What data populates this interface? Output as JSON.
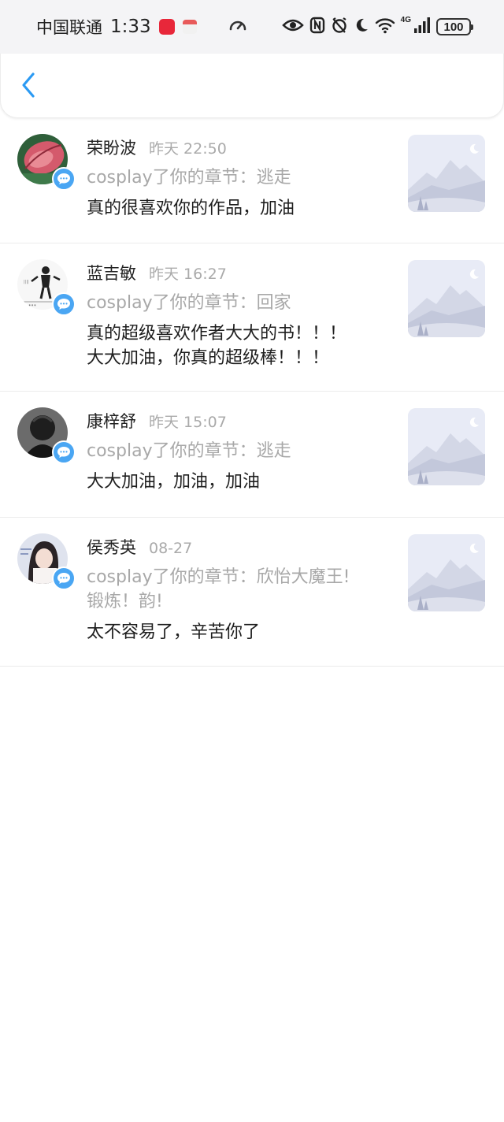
{
  "status_bar": {
    "carrier": "中国联通",
    "time": "1:33",
    "app_badge_text": "小红书",
    "network": "4G",
    "battery": "100"
  },
  "nav": {
    "back_icon": "chevron-left-icon",
    "accent": "#2b9af3"
  },
  "items": [
    {
      "name": "荣盼波",
      "time": "昨天 22:50",
      "chapter": "cosplay了你的章节：逃走",
      "comment": "真的很喜欢你的作品，加油"
    },
    {
      "name": "蓝吉敏",
      "time": "昨天 16:27",
      "chapter": "cosplay了你的章节：回家",
      "comment": "真的超级喜欢作者大大的书！！！\n大大加油，你真的超级棒！！！"
    },
    {
      "name": "康梓舒",
      "time": "昨天 15:07",
      "chapter": "cosplay了你的章节：逃走",
      "comment": "大大加油，加油，加油"
    },
    {
      "name": "侯秀英",
      "time": "08-27",
      "chapter": "cosplay了你的章节：欣怡大魔王!\n锻炼！韵!",
      "comment": "太不容易了，辛苦你了"
    }
  ],
  "colors": {
    "badge_blue": "#4aa6f3",
    "secondary_text": "#a8a8a8",
    "divider": "#ebebeb"
  }
}
